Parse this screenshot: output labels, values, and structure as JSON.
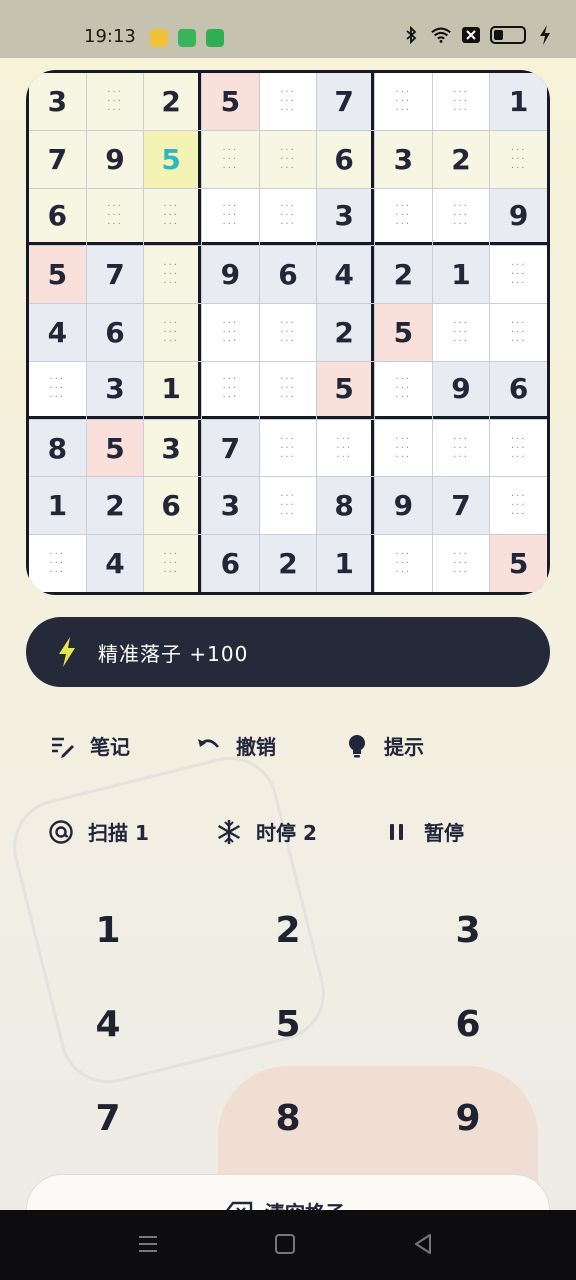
{
  "status_bar": {
    "time": "19:13",
    "app_icons": [
      {
        "name": "notes-app-icon",
        "color": "#f2c13a"
      },
      {
        "name": "game-app-icon",
        "color": "#38b55a"
      },
      {
        "name": "shield-app-icon",
        "color": "#2fae53"
      }
    ],
    "right_icons": [
      "bluetooth-icon",
      "wifi-icon",
      "x-box-icon",
      "battery-icon",
      "charging-icon"
    ]
  },
  "board": {
    "rows": [
      [
        "3",
        "",
        "2",
        "5",
        "",
        "7",
        "",
        "",
        "1"
      ],
      [
        "7",
        "9",
        "5",
        "",
        "",
        "6",
        "3",
        "2",
        ""
      ],
      [
        "6",
        "",
        "",
        "",
        "",
        "3",
        "",
        "",
        "9"
      ],
      [
        "5",
        "7",
        "",
        "9",
        "6",
        "4",
        "2",
        "1",
        ""
      ],
      [
        "4",
        "6",
        "",
        "",
        "",
        "2",
        "5",
        "",
        ""
      ],
      [
        "",
        "3",
        "1",
        "",
        "",
        "5",
        "",
        "9",
        "6"
      ],
      [
        "8",
        "5",
        "3",
        "7",
        "",
        "",
        "",
        "",
        ""
      ],
      [
        "1",
        "2",
        "6",
        "3",
        "",
        "8",
        "9",
        "7",
        ""
      ],
      [
        "",
        "4",
        "",
        "6",
        "2",
        "1",
        "",
        "",
        "5"
      ]
    ],
    "selected": {
      "row": 1,
      "col": 2,
      "color": "#2bb7c9"
    },
    "colors": {
      "cream": "#f7f6e2",
      "selected_bg": "#f3f3b4",
      "blue_gray": "#e8ecf2",
      "pink": "#fae0da",
      "white": "#ffffff"
    }
  },
  "toast": {
    "text": "精准落子 +100",
    "icon": "lightning-icon",
    "accent": "#e6e64a"
  },
  "tools": {
    "notes": "笔记",
    "undo": "撤销",
    "hint": "提示",
    "scan": "扫描 1",
    "freeze": "时停 2",
    "pause": "暂停"
  },
  "numpad": [
    "1",
    "2",
    "3",
    "4",
    "5",
    "6",
    "7",
    "8",
    "9"
  ],
  "clear_cell": {
    "label": "清空格子"
  }
}
